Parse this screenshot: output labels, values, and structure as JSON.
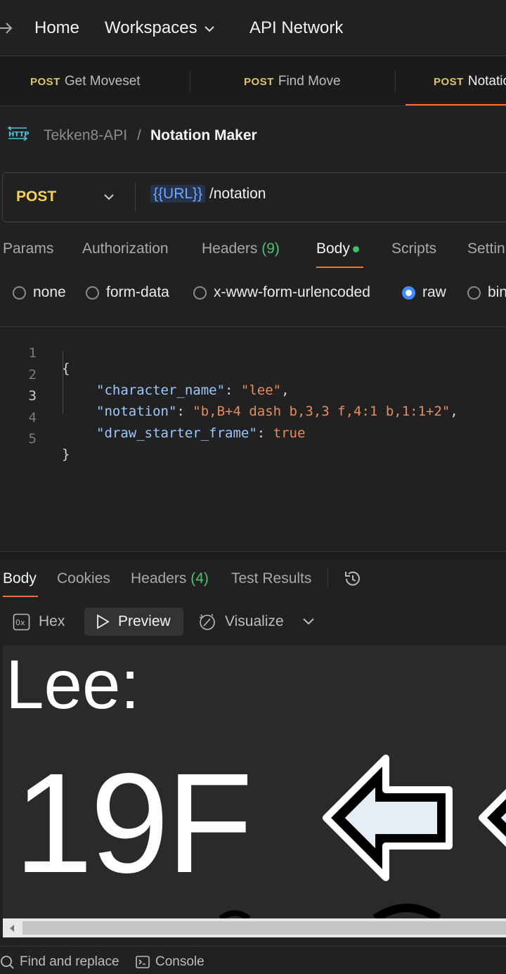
{
  "nav": {
    "home": "Home",
    "workspaces": "Workspaces",
    "api_network": "API Network"
  },
  "tabs": [
    {
      "method": "POST",
      "name": "Get Moveset"
    },
    {
      "method": "POST",
      "name": "Find Move"
    },
    {
      "method": "POST",
      "name": "Notatio"
    }
  ],
  "breadcrumb": {
    "icon": "http-icon",
    "parent": "Tekken8-API",
    "separator": "/",
    "current": "Notation Maker"
  },
  "request": {
    "method": "POST",
    "url_variable": "{{URL}}",
    "url_path": " /notation"
  },
  "request_tabs": {
    "params": "Params",
    "authorization": "Authorization",
    "headers": "Headers",
    "headers_count": "(9)",
    "body": "Body",
    "scripts": "Scripts",
    "settings": "Settin"
  },
  "body_types": {
    "none": "none",
    "form_data": "form-data",
    "urlencoded": "x-www-form-urlencoded",
    "raw": "raw",
    "binary": "bin",
    "selected": "raw"
  },
  "code": {
    "line_numbers": [
      "1",
      "2",
      "3",
      "4",
      "5"
    ],
    "open_brace": "{",
    "close_brace": "}",
    "k1": "\"character_name\"",
    "v1": "\"lee\"",
    "k2": "\"notation\"",
    "v2": "\"b,B+4 dash b,3,3 f,4:1 b,1:1+2\"",
    "k3": "\"draw_starter_frame\"",
    "v3": "true",
    "colon": ": ",
    "comma": ","
  },
  "response_tabs": {
    "body": "Body",
    "cookies": "Cookies",
    "headers": "Headers",
    "headers_count": "(4)",
    "test_results": "Test Results"
  },
  "view_modes": {
    "hex": "Hex",
    "preview": "Preview",
    "visualize": "Visualize"
  },
  "preview": {
    "character": "Lee:",
    "frame": "19F"
  },
  "footer": {
    "find_replace": "Find and replace",
    "console": "Console"
  },
  "colors": {
    "accent": "#ff6c37",
    "method_post": "#f5d05a",
    "count_green": "#4cc36e",
    "radio_on": "#3d8bff"
  }
}
